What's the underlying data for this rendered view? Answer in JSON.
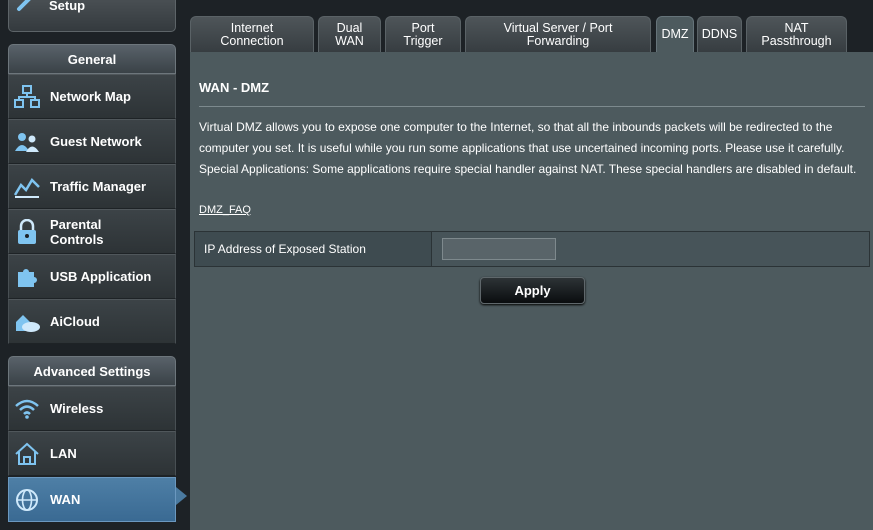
{
  "sidebar": {
    "quick_setup": {
      "label": "Quick Internet Setup",
      "icon": "wand-icon"
    },
    "general": {
      "header": "General",
      "items": [
        {
          "label": "Network Map",
          "icon": "network-map-icon"
        },
        {
          "label": "Guest Network",
          "icon": "guest-network-icon"
        },
        {
          "label": "Traffic Manager",
          "icon": "traffic-manager-icon"
        },
        {
          "label": "Parental Controls",
          "label_line1": "Parental",
          "label_line2": "Controls",
          "icon": "lock-icon"
        },
        {
          "label": "USB Application",
          "icon": "puzzle-icon"
        },
        {
          "label": "AiCloud",
          "icon": "cloud-house-icon"
        }
      ]
    },
    "advanced": {
      "header": "Advanced Settings",
      "items": [
        {
          "label": "Wireless",
          "icon": "wifi-icon"
        },
        {
          "label": "LAN",
          "icon": "house-icon"
        },
        {
          "label": "WAN",
          "icon": "globe-icon",
          "active": true
        }
      ]
    }
  },
  "tabs": [
    {
      "line1": "Internet",
      "line2": "Connection"
    },
    {
      "line1": "Dual",
      "line2": "WAN"
    },
    {
      "line1": "Port",
      "line2": "Trigger"
    },
    {
      "line1": "Virtual Server / Port",
      "line2": "Forwarding"
    },
    {
      "line1": "DMZ",
      "line2": "",
      "active": true
    },
    {
      "line1": "DDNS",
      "line2": ""
    },
    {
      "line1": "NAT",
      "line2": "Passthrough"
    }
  ],
  "main": {
    "title": "WAN - DMZ",
    "description_1": "Virtual DMZ allows you to expose one computer to the Internet, so that all the inbounds packets will be redirected to the computer you set. It is useful while you run some applications that use uncertained incoming ports. Please use it carefully.",
    "description_2": "Special Applications: Some applications require special handler against NAT. These special handlers are disabled in default.",
    "faq_link": "DMZ_FAQ",
    "form": {
      "label": "IP Address of Exposed Station",
      "value": "",
      "placeholder": ""
    },
    "apply_label": "Apply"
  },
  "colors": {
    "background": "#1d2226",
    "panel": "#4d5a5e",
    "active_menu": "#4a7aa0",
    "icon_blue": "#6fb7e6"
  }
}
